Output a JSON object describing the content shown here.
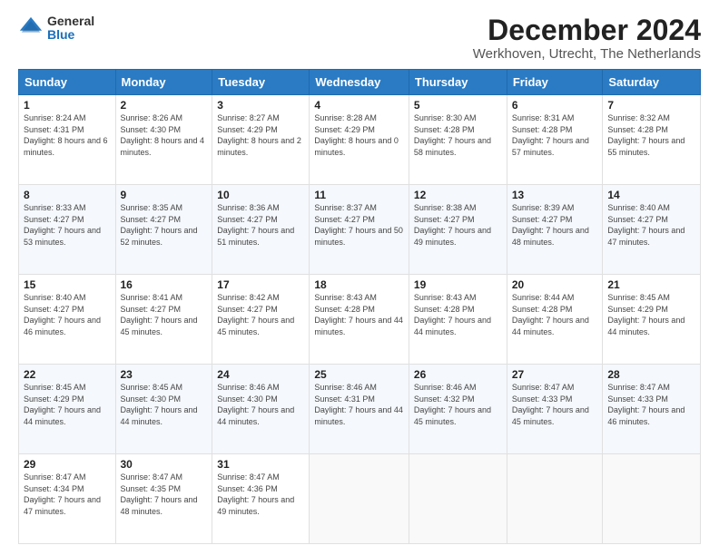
{
  "logo": {
    "general": "General",
    "blue": "Blue"
  },
  "title": "December 2024",
  "location": "Werkhoven, Utrecht, The Netherlands",
  "days_of_week": [
    "Sunday",
    "Monday",
    "Tuesday",
    "Wednesday",
    "Thursday",
    "Friday",
    "Saturday"
  ],
  "weeks": [
    [
      {
        "day": "1",
        "sunrise": "8:24 AM",
        "sunset": "4:31 PM",
        "daylight": "8 hours and 6 minutes."
      },
      {
        "day": "2",
        "sunrise": "8:26 AM",
        "sunset": "4:30 PM",
        "daylight": "8 hours and 4 minutes."
      },
      {
        "day": "3",
        "sunrise": "8:27 AM",
        "sunset": "4:29 PM",
        "daylight": "8 hours and 2 minutes."
      },
      {
        "day": "4",
        "sunrise": "8:28 AM",
        "sunset": "4:29 PM",
        "daylight": "8 hours and 0 minutes."
      },
      {
        "day": "5",
        "sunrise": "8:30 AM",
        "sunset": "4:28 PM",
        "daylight": "7 hours and 58 minutes."
      },
      {
        "day": "6",
        "sunrise": "8:31 AM",
        "sunset": "4:28 PM",
        "daylight": "7 hours and 57 minutes."
      },
      {
        "day": "7",
        "sunrise": "8:32 AM",
        "sunset": "4:28 PM",
        "daylight": "7 hours and 55 minutes."
      }
    ],
    [
      {
        "day": "8",
        "sunrise": "8:33 AM",
        "sunset": "4:27 PM",
        "daylight": "7 hours and 53 minutes."
      },
      {
        "day": "9",
        "sunrise": "8:35 AM",
        "sunset": "4:27 PM",
        "daylight": "7 hours and 52 minutes."
      },
      {
        "day": "10",
        "sunrise": "8:36 AM",
        "sunset": "4:27 PM",
        "daylight": "7 hours and 51 minutes."
      },
      {
        "day": "11",
        "sunrise": "8:37 AM",
        "sunset": "4:27 PM",
        "daylight": "7 hours and 50 minutes."
      },
      {
        "day": "12",
        "sunrise": "8:38 AM",
        "sunset": "4:27 PM",
        "daylight": "7 hours and 49 minutes."
      },
      {
        "day": "13",
        "sunrise": "8:39 AM",
        "sunset": "4:27 PM",
        "daylight": "7 hours and 48 minutes."
      },
      {
        "day": "14",
        "sunrise": "8:40 AM",
        "sunset": "4:27 PM",
        "daylight": "7 hours and 47 minutes."
      }
    ],
    [
      {
        "day": "15",
        "sunrise": "8:40 AM",
        "sunset": "4:27 PM",
        "daylight": "7 hours and 46 minutes."
      },
      {
        "day": "16",
        "sunrise": "8:41 AM",
        "sunset": "4:27 PM",
        "daylight": "7 hours and 45 minutes."
      },
      {
        "day": "17",
        "sunrise": "8:42 AM",
        "sunset": "4:27 PM",
        "daylight": "7 hours and 45 minutes."
      },
      {
        "day": "18",
        "sunrise": "8:43 AM",
        "sunset": "4:28 PM",
        "daylight": "7 hours and 44 minutes."
      },
      {
        "day": "19",
        "sunrise": "8:43 AM",
        "sunset": "4:28 PM",
        "daylight": "7 hours and 44 minutes."
      },
      {
        "day": "20",
        "sunrise": "8:44 AM",
        "sunset": "4:28 PM",
        "daylight": "7 hours and 44 minutes."
      },
      {
        "day": "21",
        "sunrise": "8:45 AM",
        "sunset": "4:29 PM",
        "daylight": "7 hours and 44 minutes."
      }
    ],
    [
      {
        "day": "22",
        "sunrise": "8:45 AM",
        "sunset": "4:29 PM",
        "daylight": "7 hours and 44 minutes."
      },
      {
        "day": "23",
        "sunrise": "8:45 AM",
        "sunset": "4:30 PM",
        "daylight": "7 hours and 44 minutes."
      },
      {
        "day": "24",
        "sunrise": "8:46 AM",
        "sunset": "4:30 PM",
        "daylight": "7 hours and 44 minutes."
      },
      {
        "day": "25",
        "sunrise": "8:46 AM",
        "sunset": "4:31 PM",
        "daylight": "7 hours and 44 minutes."
      },
      {
        "day": "26",
        "sunrise": "8:46 AM",
        "sunset": "4:32 PM",
        "daylight": "7 hours and 45 minutes."
      },
      {
        "day": "27",
        "sunrise": "8:47 AM",
        "sunset": "4:33 PM",
        "daylight": "7 hours and 45 minutes."
      },
      {
        "day": "28",
        "sunrise": "8:47 AM",
        "sunset": "4:33 PM",
        "daylight": "7 hours and 46 minutes."
      }
    ],
    [
      {
        "day": "29",
        "sunrise": "8:47 AM",
        "sunset": "4:34 PM",
        "daylight": "7 hours and 47 minutes."
      },
      {
        "day": "30",
        "sunrise": "8:47 AM",
        "sunset": "4:35 PM",
        "daylight": "7 hours and 48 minutes."
      },
      {
        "day": "31",
        "sunrise": "8:47 AM",
        "sunset": "4:36 PM",
        "daylight": "7 hours and 49 minutes."
      },
      null,
      null,
      null,
      null
    ]
  ],
  "labels": {
    "sunrise": "Sunrise:",
    "sunset": "Sunset:",
    "daylight": "Daylight:"
  }
}
